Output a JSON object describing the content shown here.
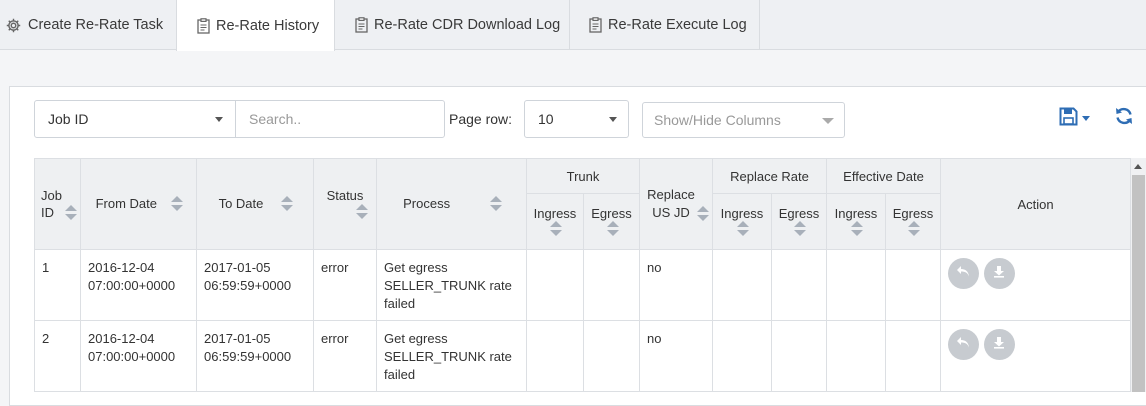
{
  "tabs": [
    {
      "label": "Create Re-Rate Task",
      "icon": "gear-icon"
    },
    {
      "label": "Re-Rate History",
      "icon": "clipboard-icon"
    },
    {
      "label": "Re-Rate CDR Download Log",
      "icon": "clipboard-icon"
    },
    {
      "label": "Re-Rate Execute Log",
      "icon": "clipboard-icon"
    }
  ],
  "toolbar": {
    "filter_field": "Job ID",
    "search_placeholder": "Search..",
    "page_row_label": "Page row:",
    "page_row_value": "10",
    "columns_placeholder": "Show/Hide Columns"
  },
  "table": {
    "headers": {
      "job_id": "Job ID",
      "from_date": "From Date",
      "to_date": "To Date",
      "status": "Status",
      "process": "Process",
      "trunk": "Trunk",
      "replace_us_jd": "Replace US JD",
      "replace_rate": "Replace Rate",
      "effective_date": "Effective Date",
      "ingress": "Ingress",
      "egress": "Egress",
      "action": "Action"
    },
    "rows": [
      {
        "job_id": "1",
        "from_date": "2016-12-04 07:00:00+0000",
        "to_date": "2017-01-05 06:59:59+0000",
        "status": "error",
        "process": "Get egress SELLER_TRUNK rate failed",
        "replace_us_jd": "no"
      },
      {
        "job_id": "2",
        "from_date": "2016-12-04 07:00:00+0000",
        "to_date": "2017-01-05 06:59:59+0000",
        "status": "error",
        "process": "Get egress SELLER_TRUNK rate failed",
        "replace_us_jd": "no"
      }
    ]
  },
  "colors": {
    "accent": "#2e6db4",
    "action_button": "#c7cbd0",
    "header_bg": "#eef0f2"
  }
}
